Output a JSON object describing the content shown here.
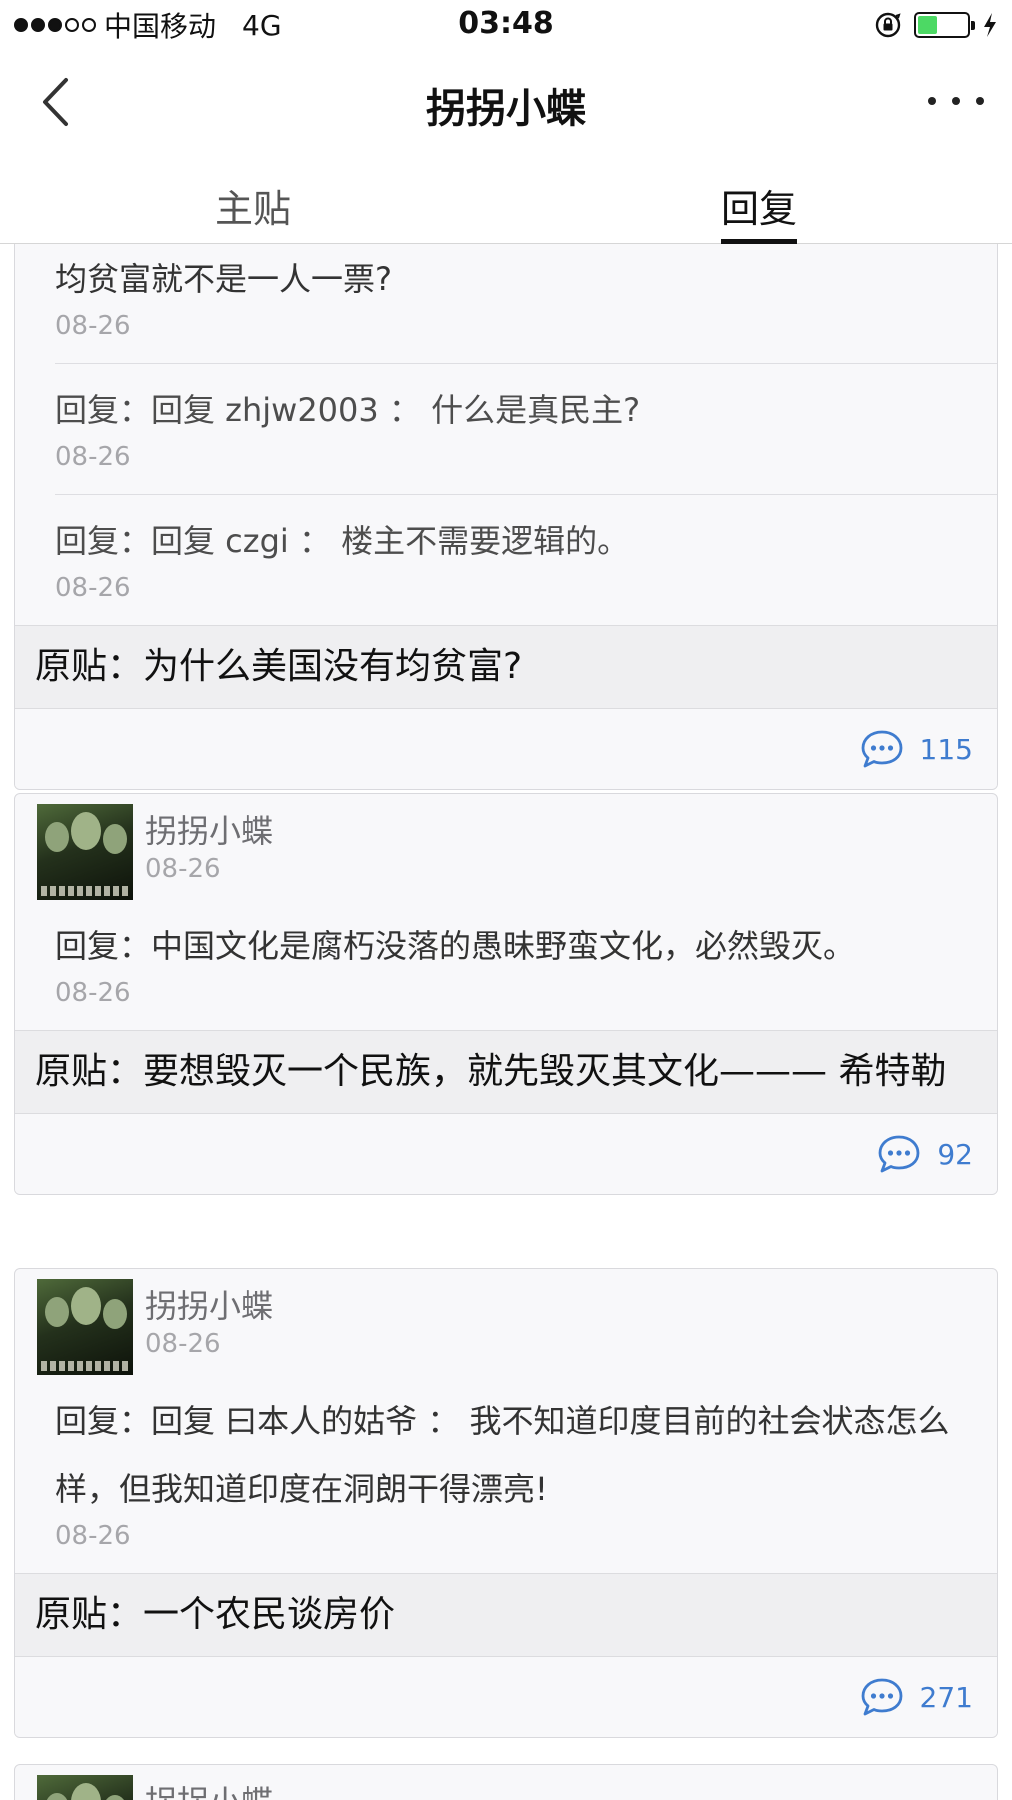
{
  "status_bar": {
    "carrier": "中国移动",
    "network": "4G",
    "time": "03:48"
  },
  "nav": {
    "title": "拐拐小蝶"
  },
  "tabs": [
    {
      "label": "主贴",
      "active": false
    },
    {
      "label": "回复",
      "active": true
    }
  ],
  "cards": [
    {
      "replies": [
        {
          "text": "均贫富就不是一人一票?",
          "date": "08-26"
        },
        {
          "text": "回复：回复 zhjw2003 ： 什么是真民主?",
          "date": "08-26"
        },
        {
          "text": "回复：回复 czgi ： 楼主不需要逻辑的。",
          "date": "08-26"
        }
      ],
      "origin_label": "原贴：",
      "origin_text": "为什么美国没有均贫富?",
      "comment_count": "115"
    },
    {
      "user": "拐拐小蝶",
      "user_date": "08-26",
      "reply_text": "回复：中国文化是腐朽没落的愚昧野蛮文化，必然毁灭。",
      "reply_date": "08-26",
      "origin_label": "原贴：",
      "origin_text": "要想毁灭一个民族，就先毁灭其文化——— 希特勒",
      "comment_count": "92"
    },
    {
      "user": "拐拐小蝶",
      "user_date": "08-26",
      "reply_text": "回复：回复 曰本人的姑爷 ： 我不知道印度目前的社会状态怎么样，但我知道印度在洞朗干得漂亮!",
      "reply_date": "08-26",
      "origin_label": "原贴：",
      "origin_text": "一个农民谈房价",
      "comment_count": "271"
    },
    {
      "user": "拐拐小蝶"
    }
  ],
  "colors": {
    "link_blue": "#3f7ccf",
    "battery_green": "#4cd964"
  }
}
